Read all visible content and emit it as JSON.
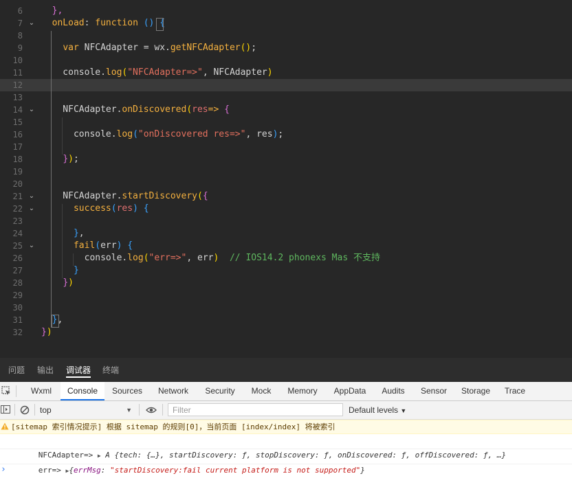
{
  "editor": {
    "lines": [
      {
        "num": "6",
        "fold": "",
        "tokens": [
          {
            "t": "  },",
            "c": "t-br2"
          }
        ]
      },
      {
        "num": "7",
        "fold": "⌄",
        "tokens": [
          {
            "t": "  ",
            "c": "t-plain"
          },
          {
            "t": "onLoad",
            "c": "t-kw"
          },
          {
            "t": ": ",
            "c": "t-plain"
          },
          {
            "t": "function",
            "c": "t-kw"
          },
          {
            "t": " ",
            "c": "t-plain"
          },
          {
            "t": "()",
            "c": "t-br3"
          },
          {
            "t": " ",
            "c": "t-plain"
          },
          {
            "t": "{",
            "c": "t-br3"
          }
        ]
      },
      {
        "num": "8",
        "fold": "",
        "tokens": []
      },
      {
        "num": "9",
        "fold": "",
        "tokens": [
          {
            "t": "    ",
            "c": "t-plain"
          },
          {
            "t": "var",
            "c": "t-kw"
          },
          {
            "t": " NFCAdapter = wx.",
            "c": "t-plain"
          },
          {
            "t": "getNFCAdapter",
            "c": "t-fn"
          },
          {
            "t": "()",
            "c": "t-br1"
          },
          {
            "t": ";",
            "c": "t-plain"
          }
        ]
      },
      {
        "num": "10",
        "fold": "",
        "tokens": []
      },
      {
        "num": "11",
        "fold": "",
        "tokens": [
          {
            "t": "    console.",
            "c": "t-plain"
          },
          {
            "t": "log",
            "c": "t-fn"
          },
          {
            "t": "(",
            "c": "t-br1"
          },
          {
            "t": "\"NFCAdapter=>\"",
            "c": "t-str"
          },
          {
            "t": ", NFCAdapter",
            "c": "t-plain"
          },
          {
            "t": ")",
            "c": "t-br1"
          }
        ]
      },
      {
        "num": "12",
        "fold": "",
        "tokens": []
      },
      {
        "num": "13",
        "fold": "",
        "tokens": []
      },
      {
        "num": "14",
        "fold": "⌄",
        "tokens": [
          {
            "t": "    NFCAdapter.",
            "c": "t-plain"
          },
          {
            "t": "onDiscovered",
            "c": "t-fn"
          },
          {
            "t": "(",
            "c": "t-br1"
          },
          {
            "t": "res",
            "c": "t-param"
          },
          {
            "t": "=> ",
            "c": "t-kw"
          },
          {
            "t": "{",
            "c": "t-br2"
          }
        ]
      },
      {
        "num": "15",
        "fold": "",
        "tokens": []
      },
      {
        "num": "16",
        "fold": "",
        "tokens": [
          {
            "t": "      console.",
            "c": "t-plain"
          },
          {
            "t": "log",
            "c": "t-fn"
          },
          {
            "t": "(",
            "c": "t-br3"
          },
          {
            "t": "\"onDiscovered res=>\"",
            "c": "t-str"
          },
          {
            "t": ", res",
            "c": "t-plain"
          },
          {
            "t": ")",
            "c": "t-br3"
          },
          {
            "t": ";",
            "c": "t-plain"
          }
        ]
      },
      {
        "num": "17",
        "fold": "",
        "tokens": []
      },
      {
        "num": "18",
        "fold": "",
        "tokens": [
          {
            "t": "    ",
            "c": "t-plain"
          },
          {
            "t": "}",
            "c": "t-br2"
          },
          {
            "t": ")",
            "c": "t-br1"
          },
          {
            "t": ";",
            "c": "t-plain"
          }
        ]
      },
      {
        "num": "19",
        "fold": "",
        "tokens": []
      },
      {
        "num": "20",
        "fold": "",
        "tokens": []
      },
      {
        "num": "21",
        "fold": "⌄",
        "tokens": [
          {
            "t": "    NFCAdapter.",
            "c": "t-plain"
          },
          {
            "t": "startDiscovery",
            "c": "t-fn"
          },
          {
            "t": "(",
            "c": "t-br1"
          },
          {
            "t": "{",
            "c": "t-br2"
          }
        ]
      },
      {
        "num": "22",
        "fold": "⌄",
        "tokens": [
          {
            "t": "      ",
            "c": "t-plain"
          },
          {
            "t": "success",
            "c": "t-kw"
          },
          {
            "t": "(",
            "c": "t-br3"
          },
          {
            "t": "res",
            "c": "t-param"
          },
          {
            "t": ")",
            "c": "t-br3"
          },
          {
            "t": " ",
            "c": "t-plain"
          },
          {
            "t": "{",
            "c": "t-br3"
          }
        ]
      },
      {
        "num": "23",
        "fold": "",
        "tokens": []
      },
      {
        "num": "24",
        "fold": "",
        "tokens": [
          {
            "t": "      ",
            "c": "t-plain"
          },
          {
            "t": "}",
            "c": "t-br3"
          },
          {
            "t": ",",
            "c": "t-plain"
          }
        ]
      },
      {
        "num": "25",
        "fold": "⌄",
        "tokens": [
          {
            "t": "      ",
            "c": "t-plain"
          },
          {
            "t": "fail",
            "c": "t-kw"
          },
          {
            "t": "(",
            "c": "t-br3"
          },
          {
            "t": "err",
            "c": "t-plain"
          },
          {
            "t": ")",
            "c": "t-br3"
          },
          {
            "t": " ",
            "c": "t-plain"
          },
          {
            "t": "{",
            "c": "t-br3"
          }
        ]
      },
      {
        "num": "26",
        "fold": "",
        "tokens": [
          {
            "t": "        console.",
            "c": "t-plain"
          },
          {
            "t": "log",
            "c": "t-fn"
          },
          {
            "t": "(",
            "c": "t-br1"
          },
          {
            "t": "\"err=>\"",
            "c": "t-str"
          },
          {
            "t": ", err",
            "c": "t-plain"
          },
          {
            "t": ")",
            "c": "t-br1"
          },
          {
            "t": "  // IOS14.2 phonexs Mas 不支持",
            "c": "t-cm"
          }
        ]
      },
      {
        "num": "27",
        "fold": "",
        "tokens": [
          {
            "t": "      ",
            "c": "t-plain"
          },
          {
            "t": "}",
            "c": "t-br3"
          }
        ]
      },
      {
        "num": "28",
        "fold": "",
        "tokens": [
          {
            "t": "    ",
            "c": "t-plain"
          },
          {
            "t": "}",
            "c": "t-br2"
          },
          {
            "t": ")",
            "c": "t-br1"
          }
        ]
      },
      {
        "num": "29",
        "fold": "",
        "tokens": []
      },
      {
        "num": "30",
        "fold": "",
        "tokens": []
      },
      {
        "num": "31",
        "fold": "",
        "tokens": [
          {
            "t": "  ",
            "c": "t-plain"
          },
          {
            "t": "}",
            "c": "t-br3"
          },
          {
            "t": ",",
            "c": "t-plain"
          }
        ]
      },
      {
        "num": "32",
        "fold": "",
        "tokens": [
          {
            "t": "}",
            "c": "t-br2"
          },
          {
            "t": ")",
            "c": "t-br1"
          }
        ]
      }
    ],
    "current_line": "12"
  },
  "panel_tabs": [
    {
      "label": "问题",
      "active": false
    },
    {
      "label": "输出",
      "active": false
    },
    {
      "label": "调试器",
      "active": true
    },
    {
      "label": "终端",
      "active": false
    }
  ],
  "devtools_tabs": [
    {
      "label": "Wxml",
      "active": false
    },
    {
      "label": "Console",
      "active": true
    },
    {
      "label": "Sources",
      "active": false
    },
    {
      "label": "Network",
      "active": false
    },
    {
      "label": "Security",
      "active": false
    },
    {
      "label": "Mock",
      "active": false
    },
    {
      "label": "Memory",
      "active": false
    },
    {
      "label": "AppData",
      "active": false
    },
    {
      "label": "Audits",
      "active": false
    },
    {
      "label": "Sensor",
      "active": false
    },
    {
      "label": "Storage",
      "active": false
    },
    {
      "label": "Trace",
      "active": false
    }
  ],
  "toolbar": {
    "context": "top",
    "filter_placeholder": "Filter",
    "levels_label": "Default levels"
  },
  "console": {
    "warning": "[sitemap 索引情况提示] 根据 sitemap 的规则[0]，当前页面 [index/index] 将被索引",
    "log1_label": "NFCAdapter=> ",
    "log1_type": "A",
    "log1_body": " {tech: {…}, startDiscovery: ƒ, stopDiscovery: ƒ, onDiscovered: ƒ, offDiscovered: ƒ, …}",
    "log2_label": "err=> ",
    "log2_key": "errMsg",
    "log2_value": "\"startDiscovery:fail current platform is not supported\""
  }
}
